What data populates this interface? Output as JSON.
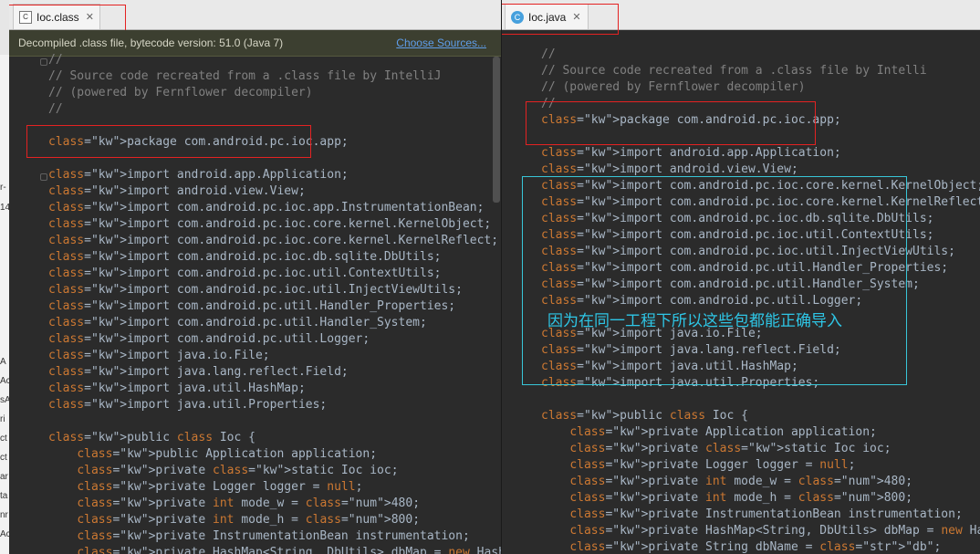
{
  "left": {
    "tab_label": "Ioc.class",
    "tab_icon": "class-file-icon",
    "banner_text": "Decompiled .class file, bytecode version: 51.0 (Java 7)",
    "banner_link": "Choose Sources...",
    "code": [
      "//",
      "// Source code recreated from a .class file by IntelliJ",
      "// (powered by Fernflower decompiler)",
      "//",
      "",
      "package com.android.pc.ioc.app;",
      "",
      "import android.app.Application;",
      "import android.view.View;",
      "import com.android.pc.ioc.app.InstrumentationBean;",
      "import com.android.pc.ioc.core.kernel.KernelObject;",
      "import com.android.pc.ioc.core.kernel.KernelReflect;",
      "import com.android.pc.ioc.db.sqlite.DbUtils;",
      "import com.android.pc.ioc.util.ContextUtils;",
      "import com.android.pc.ioc.util.InjectViewUtils;",
      "import com.android.pc.util.Handler_Properties;",
      "import com.android.pc.util.Handler_System;",
      "import com.android.pc.util.Logger;",
      "import java.io.File;",
      "import java.lang.reflect.Field;",
      "import java.util.HashMap;",
      "import java.util.Properties;",
      "",
      "public class Ioc {",
      "    public Application application;",
      "    private static Ioc ioc;",
      "    private Logger logger = null;",
      "    private int mode_w = 480;",
      "    private int mode_h = 800;",
      "    private InstrumentationBean instrumentation;",
      "    private HashMap<String, DbUtils> dbMap = new HashMap"
    ]
  },
  "right": {
    "tab_label": "Ioc.java",
    "tab_icon": "java-class-icon",
    "annotation": "因为在同一工程下所以这些包都能正确导入",
    "code": [
      "",
      "//",
      "// Source code recreated from a .class file by Intelli",
      "// (powered by Fernflower decompiler)",
      "//",
      "package com.android.pc.ioc.app;",
      "",
      "import android.app.Application;",
      "import android.view.View;",
      "import com.android.pc.ioc.core.kernel.KernelObject;",
      "import com.android.pc.ioc.core.kernel.KernelReflect;",
      "import com.android.pc.ioc.db.sqlite.DbUtils;",
      "import com.android.pc.ioc.util.ContextUtils;",
      "import com.android.pc.ioc.util.InjectViewUtils;",
      "import com.android.pc.util.Handler_Properties;",
      "import com.android.pc.util.Handler_System;",
      "import com.android.pc.util.Logger;",
      "",
      "import java.io.File;",
      "import java.lang.reflect.Field;",
      "import java.util.HashMap;",
      "import java.util.Properties;",
      "",
      "public class Ioc {",
      "    private Application application;",
      "    private static Ioc ioc;",
      "    private Logger logger = null;",
      "    private int mode_w = 480;",
      "    private int mode_h = 800;",
      "    private InstrumentationBean instrumentation;",
      "    private HashMap<String, DbUtils> dbMap = new HashM",
      "    private String dbName = \"db\";"
    ]
  },
  "edge_fragments": [
    "r-",
    "14",
    "A",
    "Ac",
    "sA",
    "ri",
    "ct",
    "ct",
    "ar",
    "ta",
    "nr",
    "Ac"
  ],
  "colors": {
    "keyword": "#cc7832",
    "comment": "#808080",
    "number": "#6897bb",
    "string": "#6a8759",
    "field": "#9876aa",
    "annotation_box": "#38c6d8",
    "highlight_box": "#e42222"
  }
}
